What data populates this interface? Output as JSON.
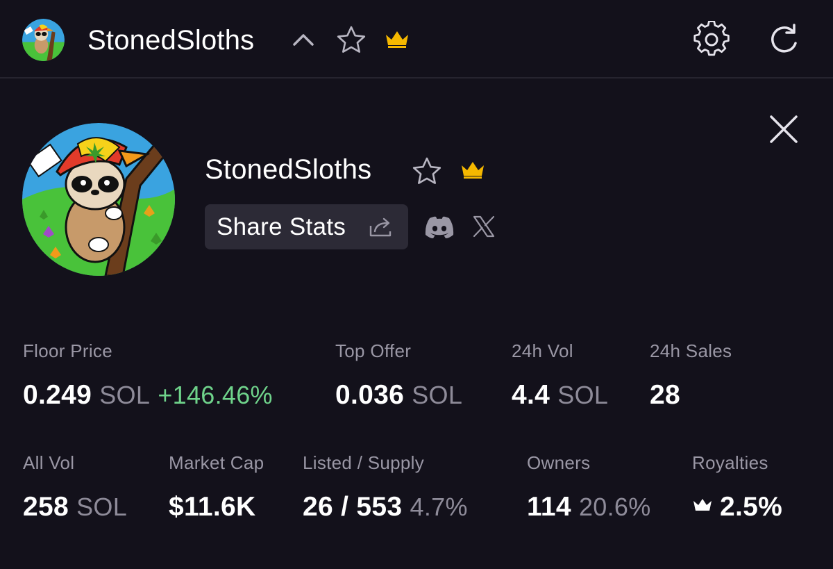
{
  "header": {
    "title": "StonedSloths",
    "icons": [
      "chevron-up-icon",
      "star-icon",
      "crown-icon",
      "gear-icon",
      "refresh-icon"
    ]
  },
  "collection": {
    "name": "StonedSloths",
    "share_label": "Share Stats",
    "social_icons": [
      "discord-icon",
      "x-icon"
    ]
  },
  "stats": {
    "floor_price": {
      "label": "Floor Price",
      "value": "0.249",
      "unit": "SOL",
      "change": "+146.46%"
    },
    "top_offer": {
      "label": "Top Offer",
      "value": "0.036",
      "unit": "SOL"
    },
    "vol_24h": {
      "label": "24h Vol",
      "value": "4.4",
      "unit": "SOL"
    },
    "sales_24h": {
      "label": "24h Sales",
      "value": "28"
    },
    "all_vol": {
      "label": "All Vol",
      "value": "258",
      "unit": "SOL"
    },
    "market_cap": {
      "label": "Market Cap",
      "value": "$11.6K"
    },
    "listed_supply": {
      "label": "Listed / Supply",
      "value": "26 / 553",
      "pct": "4.7%"
    },
    "owners": {
      "label": "Owners",
      "value": "114",
      "pct": "20.6%"
    },
    "royalties": {
      "label": "Royalties",
      "value": "2.5%"
    }
  },
  "colors": {
    "background": "#13111b",
    "accent_gold": "#f5b800",
    "positive": "#6fd38b",
    "muted": "#9a97a5",
    "button_bg": "#2c2a36"
  }
}
